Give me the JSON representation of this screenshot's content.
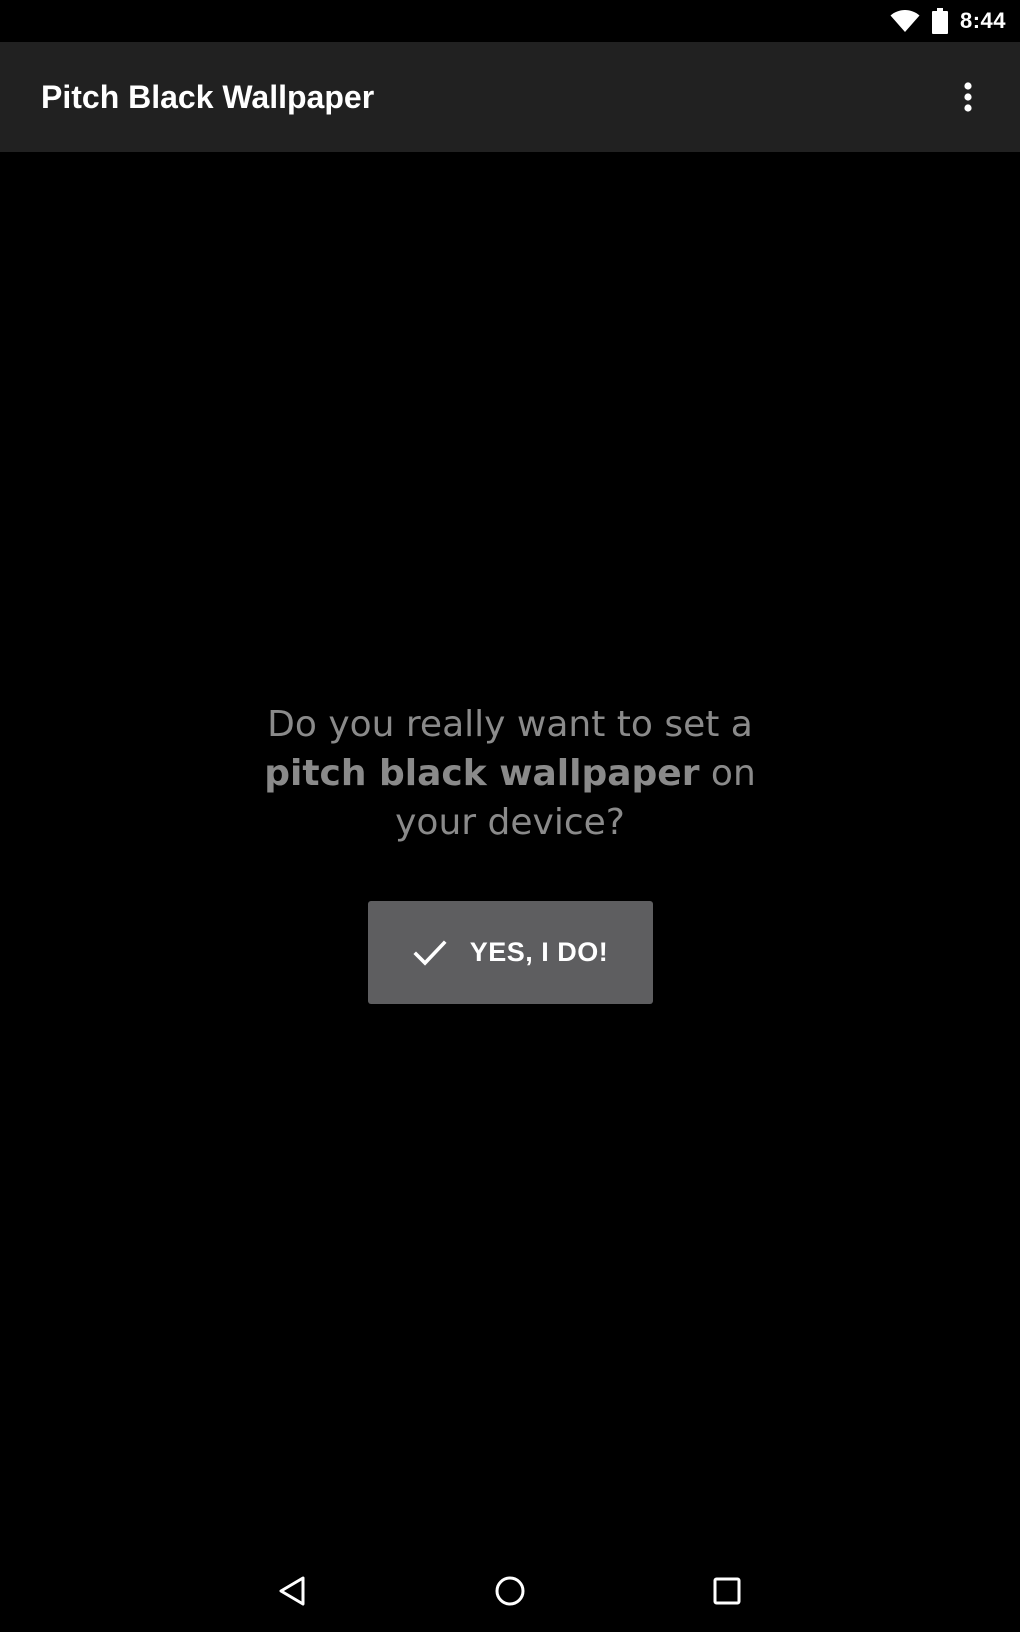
{
  "status_bar": {
    "time": "8:44",
    "icons": [
      "wifi-icon",
      "battery-icon"
    ]
  },
  "app_bar": {
    "title": "Pitch Black Wallpaper",
    "overflow_icon": "more-vert-icon"
  },
  "content": {
    "question_part1": "Do you really want to set a ",
    "question_bold": "pitch black wallpaper",
    "question_part2": " on your device?",
    "confirm_button_label": "YES, I DO!",
    "confirm_button_icon": "check-icon"
  },
  "nav_bar": {
    "icons": [
      "back-icon",
      "home-icon",
      "recents-icon"
    ]
  },
  "colors": {
    "background": "#000000",
    "app_bar": "#212121",
    "question_text": "#8a8a8a",
    "button_background": "#5e5e60",
    "button_text": "#ffffff"
  }
}
